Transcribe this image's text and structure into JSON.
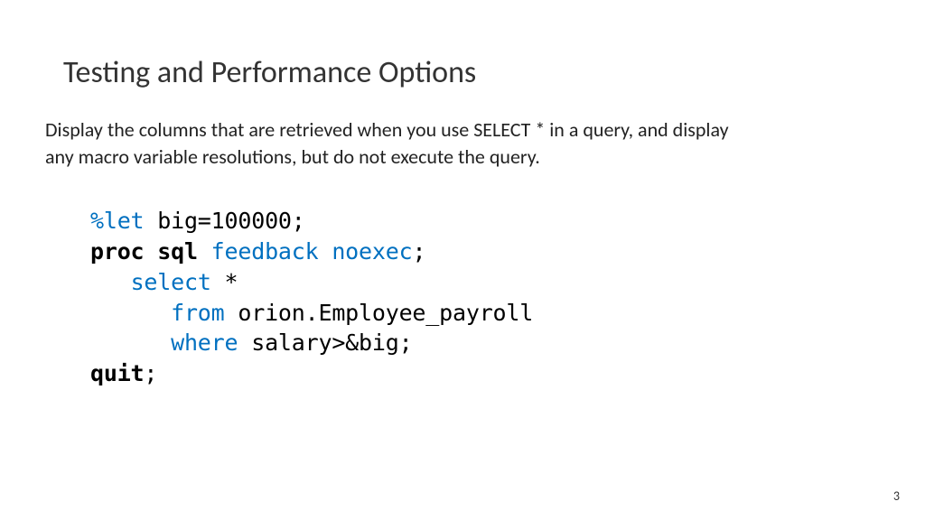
{
  "title": "Testing and Performance Options",
  "description": "Display the columns that are retrieved when you use SELECT * in a query, and display any macro variable resolutions, but do not execute the query.",
  "code": {
    "line1_kw": "%let",
    "line1_rest": " big=100000;",
    "line2_proc": "proc sql",
    "line2_opts": " feedback noexec",
    "line2_semi": ";",
    "line3_indent": "   ",
    "line3_kw": "select",
    "line3_rest": " *",
    "line4_indent": "      ",
    "line4_kw": "from",
    "line4_rest": " orion.Employee_payroll",
    "line5_indent": "      ",
    "line5_kw": "where",
    "line5_rest": " salary>&big;",
    "line6_kw": "quit",
    "line6_rest": ";"
  },
  "page_number": "3"
}
